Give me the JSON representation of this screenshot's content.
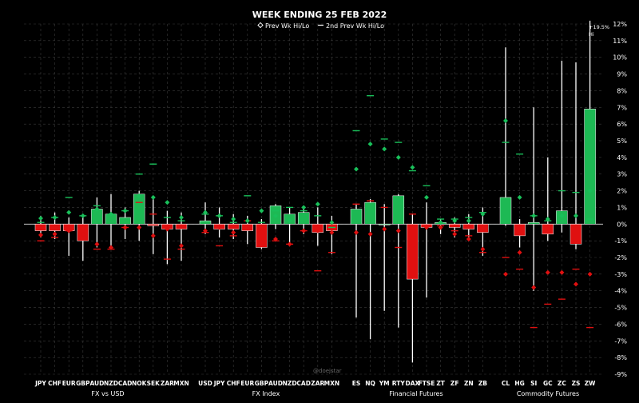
{
  "chart_data": {
    "type": "candlestick-range",
    "title": "WEEK ENDING 25 FEB 2022",
    "legend": {
      "items": [
        {
          "marker": "diamond-outline",
          "label": "Prev Wk Hi/Lo"
        },
        {
          "marker": "dash",
          "label": "2nd Prev Wk Hi/Lo"
        }
      ],
      "placement": "top-center"
    },
    "y_axis": {
      "position": "right",
      "ylim": [
        -9,
        12
      ],
      "ticks": [
        -9,
        -8,
        -7,
        -6,
        -5,
        -4,
        -3,
        -2,
        -1,
        0,
        1,
        2,
        3,
        4,
        5,
        6,
        7,
        8,
        9,
        10,
        11,
        12
      ],
      "tick_labels": [
        "-9%",
        "-8%",
        "-7%",
        "-6%",
        "-5%",
        "-4%",
        "-3%",
        "-2%",
        "-1%",
        "0%",
        "1%",
        "2%",
        "3%",
        "4%",
        "5%",
        "6%",
        "7%",
        "8%",
        "9%",
        "10%",
        "11%",
        "12%"
      ],
      "unit": "%"
    },
    "grid": true,
    "colors": {
      "up": "#1db954",
      "down": "#e01010",
      "prev": "#19c05a",
      "prev_down": "#e01010",
      "wick": "#ffffff",
      "grid": "#3a3a3a"
    },
    "annotation": {
      "label": "+19.5%\nHi",
      "lines": [
        "+19.5%",
        "Hi"
      ],
      "target": "ZW"
    },
    "watermark": "@doejstar",
    "groups": [
      {
        "name": "FX vs USD",
        "items": [
          {
            "label": "JPY",
            "close": -0.4,
            "high": 0.5,
            "low": -0.8,
            "pHi": 0.35,
            "pLo": -0.65,
            "p2Hi": 0.1,
            "p2Lo": -1.0
          },
          {
            "label": "CHF",
            "close": -0.4,
            "high": 0.7,
            "low": -0.9,
            "pHi": 0.4,
            "pLo": -0.6,
            "p2Hi": 0.4,
            "p2Lo": -0.8
          },
          {
            "label": "EUR",
            "close": -0.4,
            "high": 0.4,
            "low": -1.9,
            "pHi": 0.7,
            "pLo": -0.4,
            "p2Hi": 1.6,
            "p2Lo": -0.4
          },
          {
            "label": "GBP",
            "close": -1.0,
            "high": 0.6,
            "low": -2.2,
            "pHi": 0.5,
            "pLo": -0.6,
            "p2Hi": 0.5,
            "p2Lo": -0.7
          },
          {
            "label": "AUD",
            "close": 0.9,
            "high": 1.6,
            "low": -1.4,
            "pHi": 0.9,
            "pLo": -1.2,
            "p2Hi": 1.1,
            "p2Lo": -1.5
          },
          {
            "label": "NZD",
            "close": 0.6,
            "high": 1.8,
            "low": -1.5,
            "pHi": 0.6,
            "pLo": -1.4,
            "p2Hi": 0.6,
            "p2Lo": -1.5
          },
          {
            "label": "CAD",
            "close": 0.4,
            "high": 1.0,
            "low": -0.9,
            "pHi": 0.8,
            "pLo": -0.2,
            "p2Hi": 0.8,
            "p2Lo": -0.2
          },
          {
            "label": "NOK",
            "close": 1.8,
            "high": 2.0,
            "low": -1.0,
            "pHi": 1.7,
            "pLo": -0.2,
            "p2Hi": 3.0,
            "p2Lo": 1.3
          },
          {
            "label": "SEK",
            "close": -0.1,
            "high": 1.6,
            "low": -1.8,
            "pHi": 1.6,
            "pLo": -0.7,
            "p2Hi": 3.6,
            "p2Lo": 0.6
          },
          {
            "label": "ZAR",
            "close": -0.3,
            "high": 0.8,
            "low": -2.4,
            "pHi": 1.3,
            "pLo": -0.3,
            "p2Hi": 0.4,
            "p2Lo": -2.1
          },
          {
            "label": "MXN",
            "close": -0.3,
            "high": 0.7,
            "low": -2.2,
            "pHi": 0.4,
            "pLo": -1.3,
            "p2Hi": 0.2,
            "p2Lo": -1.5
          }
        ]
      },
      {
        "name": "FX Index",
        "items": [
          {
            "label": "USD",
            "close": 0.2,
            "high": 1.3,
            "low": -0.6,
            "pHi": 0.7,
            "pLo": -0.4,
            "p2Hi": 0.6,
            "p2Lo": -0.5
          },
          {
            "label": "JPY",
            "close": -0.3,
            "high": 1.0,
            "low": -0.8,
            "pHi": 0.5,
            "pLo": -0.2,
            "p2Hi": 0.5,
            "p2Lo": -1.3
          },
          {
            "label": "CHF",
            "close": -0.3,
            "high": 0.6,
            "low": -0.9,
            "pHi": 0.3,
            "pLo": -0.5,
            "p2Hi": 0.1,
            "p2Lo": -0.7
          },
          {
            "label": "EUR",
            "close": -0.4,
            "high": 0.5,
            "low": -1.2,
            "pHi": 0.2,
            "pLo": -0.2,
            "p2Hi": 1.7,
            "p2Lo": 0.2
          },
          {
            "label": "GBP",
            "close": -1.4,
            "high": 0.3,
            "low": -1.5,
            "pHi": 0.8,
            "pLo": -0.3,
            "p2Hi": 0.1,
            "p2Lo": -1.2
          },
          {
            "label": "AUD",
            "close": 1.1,
            "high": 1.2,
            "low": -0.3,
            "pHi": 0.5,
            "pLo": -0.9,
            "p2Hi": 0.8,
            "p2Lo": -1.0
          },
          {
            "label": "NZD",
            "close": 0.6,
            "high": 1.0,
            "low": -1.3,
            "pHi": 0.2,
            "pLo": -1.2,
            "p2Hi": 1.0,
            "p2Lo": -1.2
          },
          {
            "label": "CAD",
            "close": 0.7,
            "high": 1.1,
            "low": -0.6,
            "pHi": 1.0,
            "pLo": -0.4,
            "p2Hi": 0.8,
            "p2Lo": -0.4
          },
          {
            "label": "ZAR",
            "close": -0.5,
            "high": 1.0,
            "low": -1.3,
            "pHi": 1.2,
            "pLo": -0.4,
            "p2Hi": 0.5,
            "p2Lo": -2.8
          },
          {
            "label": "MXN",
            "close": -0.4,
            "high": 0.5,
            "low": -1.8,
            "pHi": 0.1,
            "pLo": -0.5,
            "p2Hi": -0.2,
            "p2Lo": -1.7
          }
        ]
      },
      {
        "name": "Financial Futures",
        "items": [
          {
            "label": "ES",
            "close": 0.9,
            "high": 1.2,
            "low": -5.6,
            "pHi": 3.3,
            "pLo": -0.5,
            "p2Hi": 5.6,
            "p2Lo": 1.2
          },
          {
            "label": "NQ",
            "close": 1.3,
            "high": 1.5,
            "low": -6.9,
            "pHi": 4.8,
            "pLo": -0.6,
            "p2Hi": 7.7,
            "p2Lo": 1.4
          },
          {
            "label": "YM",
            "close": 0.0,
            "high": 1.2,
            "low": -5.2,
            "pHi": 4.5,
            "pLo": -0.3,
            "p2Hi": 5.1,
            "p2Lo": 1.0
          },
          {
            "label": "RTY",
            "close": 1.7,
            "high": 1.8,
            "low": -6.2,
            "pHi": 4.0,
            "pLo": -0.4,
            "p2Hi": 4.9,
            "p2Lo": -1.4
          },
          {
            "label": "DAX",
            "close": -3.3,
            "high": 0.6,
            "low": -8.3,
            "pHi": 3.4,
            "pLo": -1.3,
            "p2Hi": 3.2,
            "p2Lo": 0.6
          },
          {
            "label": "FTSE",
            "close": -0.2,
            "high": 1.3,
            "low": -4.4,
            "pHi": 1.6,
            "pLo": -0.2,
            "p2Hi": 2.3,
            "p2Lo": -0.1
          },
          {
            "label": "ZT",
            "close": 0.1,
            "high": 0.3,
            "low": -0.6,
            "pHi": 0.1,
            "pLo": -0.2,
            "p2Hi": 0.3,
            "p2Lo": -0.1
          },
          {
            "label": "ZF",
            "close": -0.2,
            "high": 0.4,
            "low": -0.8,
            "pHi": 0.2,
            "pLo": -0.6,
            "p2Hi": 0.3,
            "p2Lo": -0.4
          },
          {
            "label": "ZN",
            "close": -0.3,
            "high": 0.6,
            "low": -1.0,
            "pHi": 0.2,
            "pLo": -0.9,
            "p2Hi": 0.4,
            "p2Lo": -0.7
          },
          {
            "label": "ZB",
            "close": -0.5,
            "high": 1.0,
            "low": -1.9,
            "pHi": 0.6,
            "pLo": -1.5,
            "p2Hi": 0.7,
            "p2Lo": -1.7
          }
        ]
      },
      {
        "name": "Commodity Futures",
        "items": [
          {
            "label": "CL",
            "close": 1.6,
            "high": 10.6,
            "low": -0.1,
            "pHi": 6.2,
            "pLo": -3.0,
            "p2Hi": 4.9,
            "p2Lo": -2.0
          },
          {
            "label": "HG",
            "close": -0.7,
            "high": 0.3,
            "low": -1.4,
            "pHi": 1.6,
            "pLo": -1.7,
            "p2Hi": 4.2,
            "p2Lo": -2.7
          },
          {
            "label": "SI",
            "close": 0.1,
            "high": 7.0,
            "low": -4.0,
            "pHi": 0.5,
            "pLo": -3.8,
            "p2Hi": 0.5,
            "p2Lo": -6.2
          },
          {
            "label": "GC",
            "close": -0.6,
            "high": 4.0,
            "low": -1.0,
            "pHi": 0.3,
            "pLo": -2.9,
            "p2Hi": 0.2,
            "p2Lo": -4.8
          },
          {
            "label": "ZC",
            "close": 0.8,
            "high": 9.8,
            "low": -0.5,
            "pHi": 0.5,
            "pLo": -2.9,
            "p2Hi": 2.0,
            "p2Lo": -4.5
          },
          {
            "label": "ZS",
            "close": -1.2,
            "high": 9.7,
            "low": -1.5,
            "pHi": 0.5,
            "pLo": -3.6,
            "p2Hi": 1.9,
            "p2Lo": -2.7
          },
          {
            "label": "ZW",
            "close": 6.9,
            "high": 12.2,
            "low": 0.0,
            "pHi": 2.0,
            "pLo": -3.0,
            "p2Hi": 0.3,
            "p2Lo": -6.2
          }
        ]
      }
    ]
  }
}
